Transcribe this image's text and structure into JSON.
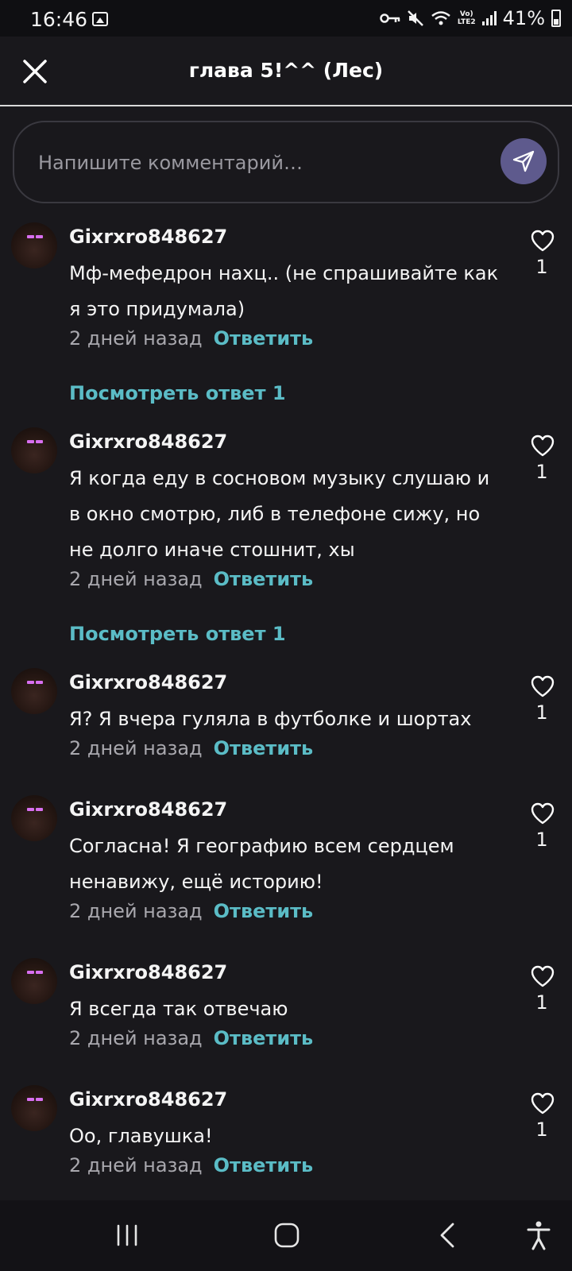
{
  "status_bar": {
    "time": "16:46",
    "battery": "41%"
  },
  "header": {
    "title": "глава 5!^^ (Лес)"
  },
  "composer": {
    "placeholder": "Напишите комментарий…"
  },
  "comments": [
    {
      "username": "Gixrxro848627",
      "text": "Мф-мефедрон нахц.. (не спрашивайте как я это придумала)",
      "time": "2 дней назад",
      "reply": "Ответить",
      "likes": "1",
      "view_replies": "Посмотреть ответ 1"
    },
    {
      "username": "Gixrxro848627",
      "text": "Я когда еду в сосновом музыку слушаю и в окно смотрю, либ в телефоне сижу, но не долго иначе стошнит, хы",
      "time": "2 дней назад",
      "reply": "Ответить",
      "likes": "1",
      "view_replies": "Посмотреть ответ 1"
    },
    {
      "username": "Gixrxro848627",
      "text": "Я? Я вчера гуляла в футболке и шортах",
      "time": "2 дней назад",
      "reply": "Ответить",
      "likes": "1"
    },
    {
      "username": "Gixrxro848627",
      "text": "Согласна! Я географию всем сердцем ненавижу, ещё историю!",
      "time": "2 дней назад",
      "reply": "Ответить",
      "likes": "1"
    },
    {
      "username": "Gixrxro848627",
      "text": "Я всегда так отвечаю",
      "time": "2 дней назад",
      "reply": "Ответить",
      "likes": "1"
    },
    {
      "username": "Gixrxro848627",
      "text": "Оо, главушка!",
      "time": "2 дней назад",
      "reply": "Ответить",
      "likes": "1"
    }
  ],
  "icons": {
    "close": "close-icon",
    "send": "send-icon",
    "like": "heart-icon",
    "nav_recents": "recents-icon",
    "nav_home": "home-icon",
    "nav_back": "back-icon",
    "nav_accessibility": "accessibility-icon"
  },
  "colors": {
    "background": "#19181c",
    "accent": "#5bbcc6",
    "send_button": "#5e5a8d",
    "muted_text": "#a9a8ae"
  }
}
